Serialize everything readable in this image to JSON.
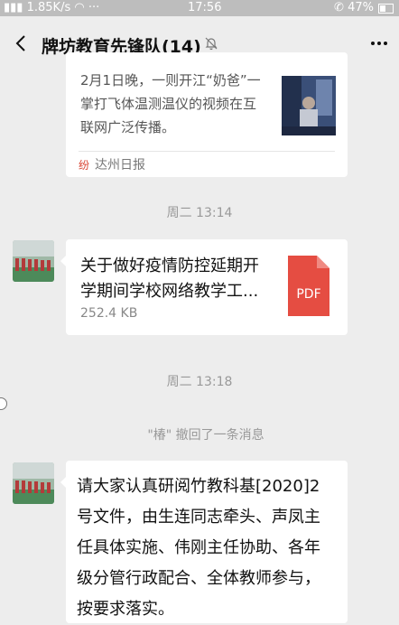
{
  "status_bar": {
    "network": "1.85K/s",
    "time": "17:56",
    "battery": "47%"
  },
  "header": {
    "title": "牌坊教育先锋队(14)",
    "more": "···"
  },
  "messages": {
    "article": {
      "lines": [
        "2月1日晚，一则开江“奶爸”一",
        "掌打飞体温测温仪的视频在互",
        "联网广泛传播。"
      ],
      "source": "达州日报"
    },
    "time1": "周二 13:14",
    "file": {
      "name_line1": "关于做好疫情防控延期开",
      "name_line2": "学期间学校网络教学工...",
      "size": "252.4 KB",
      "type": "PDF",
      "icon_color": "#e54d42"
    },
    "time2": "周二 13:18",
    "recall_notice": "\"椿\" 撤回了一条消息",
    "text_message": {
      "lines": [
        "请大家认真研阅竹教科基[2020]2",
        "号文件，由生连同志牵头、声凤主",
        "任具体实施、伟刚主任协助、各年",
        "级分管行政配合、全体教师参与，",
        "按要求落实。"
      ]
    }
  }
}
